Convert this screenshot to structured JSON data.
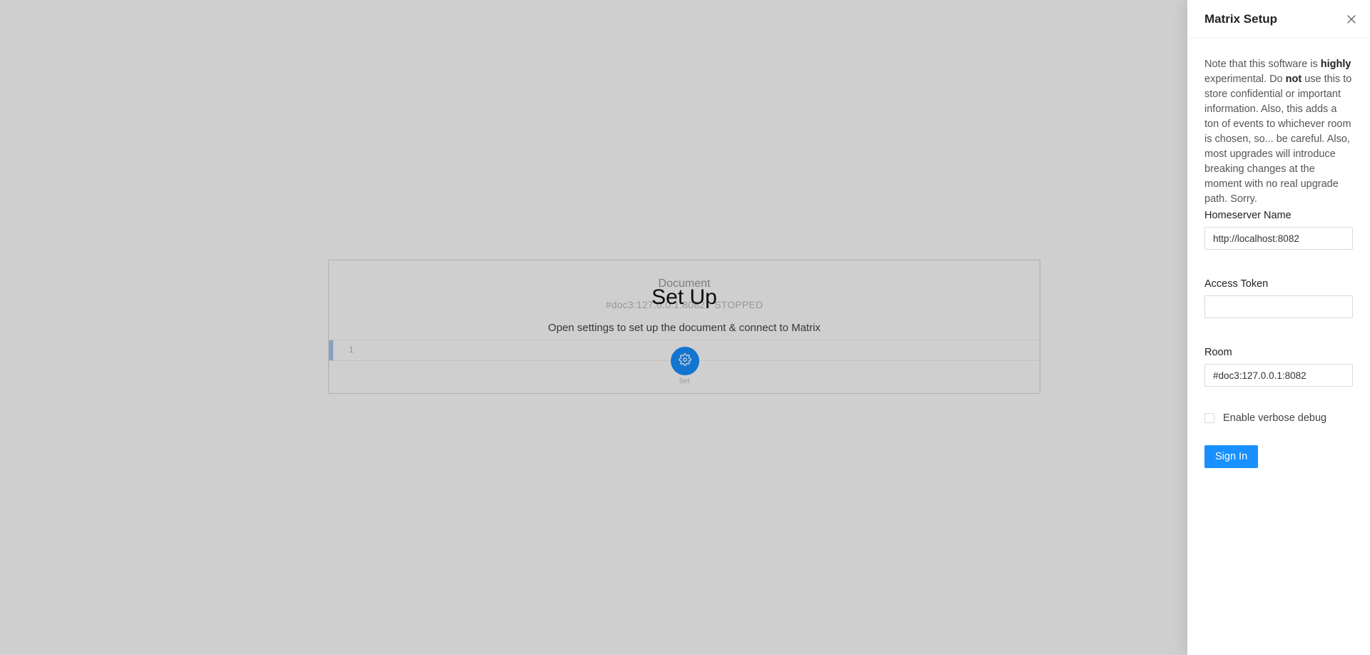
{
  "document": {
    "title": "Document",
    "subtitle": "#doc3:127.0.0.1:8082 · STOPPED",
    "line_number": "1"
  },
  "setup": {
    "title": "Set Up",
    "description": "Open settings to set up the document & connect to Matrix",
    "gear_caption": "Set"
  },
  "drawer": {
    "title": "Matrix Setup",
    "notice": {
      "p1": "Note that this software is ",
      "b1": "highly",
      "p2": " experimental. Do ",
      "b2": "not",
      "p3": " use this to store confidential or important information. Also, this adds a ton of events to whichever room is chosen, so... be careful. Also, most upgrades will introduce breaking changes at the moment with no real upgrade path. Sorry."
    },
    "homeserver": {
      "label": "Homeserver Name",
      "value": "http://localhost:8082"
    },
    "access_token": {
      "label": "Access Token",
      "value": ""
    },
    "room": {
      "label": "Room",
      "value": "#doc3:127.0.0.1:8082"
    },
    "verbose_debug": {
      "label": "Enable verbose debug",
      "checked": false
    },
    "sign_in_label": "Sign In"
  },
  "colors": {
    "accent": "#1890ff",
    "mask": "rgba(0,0,0,0.19)"
  }
}
